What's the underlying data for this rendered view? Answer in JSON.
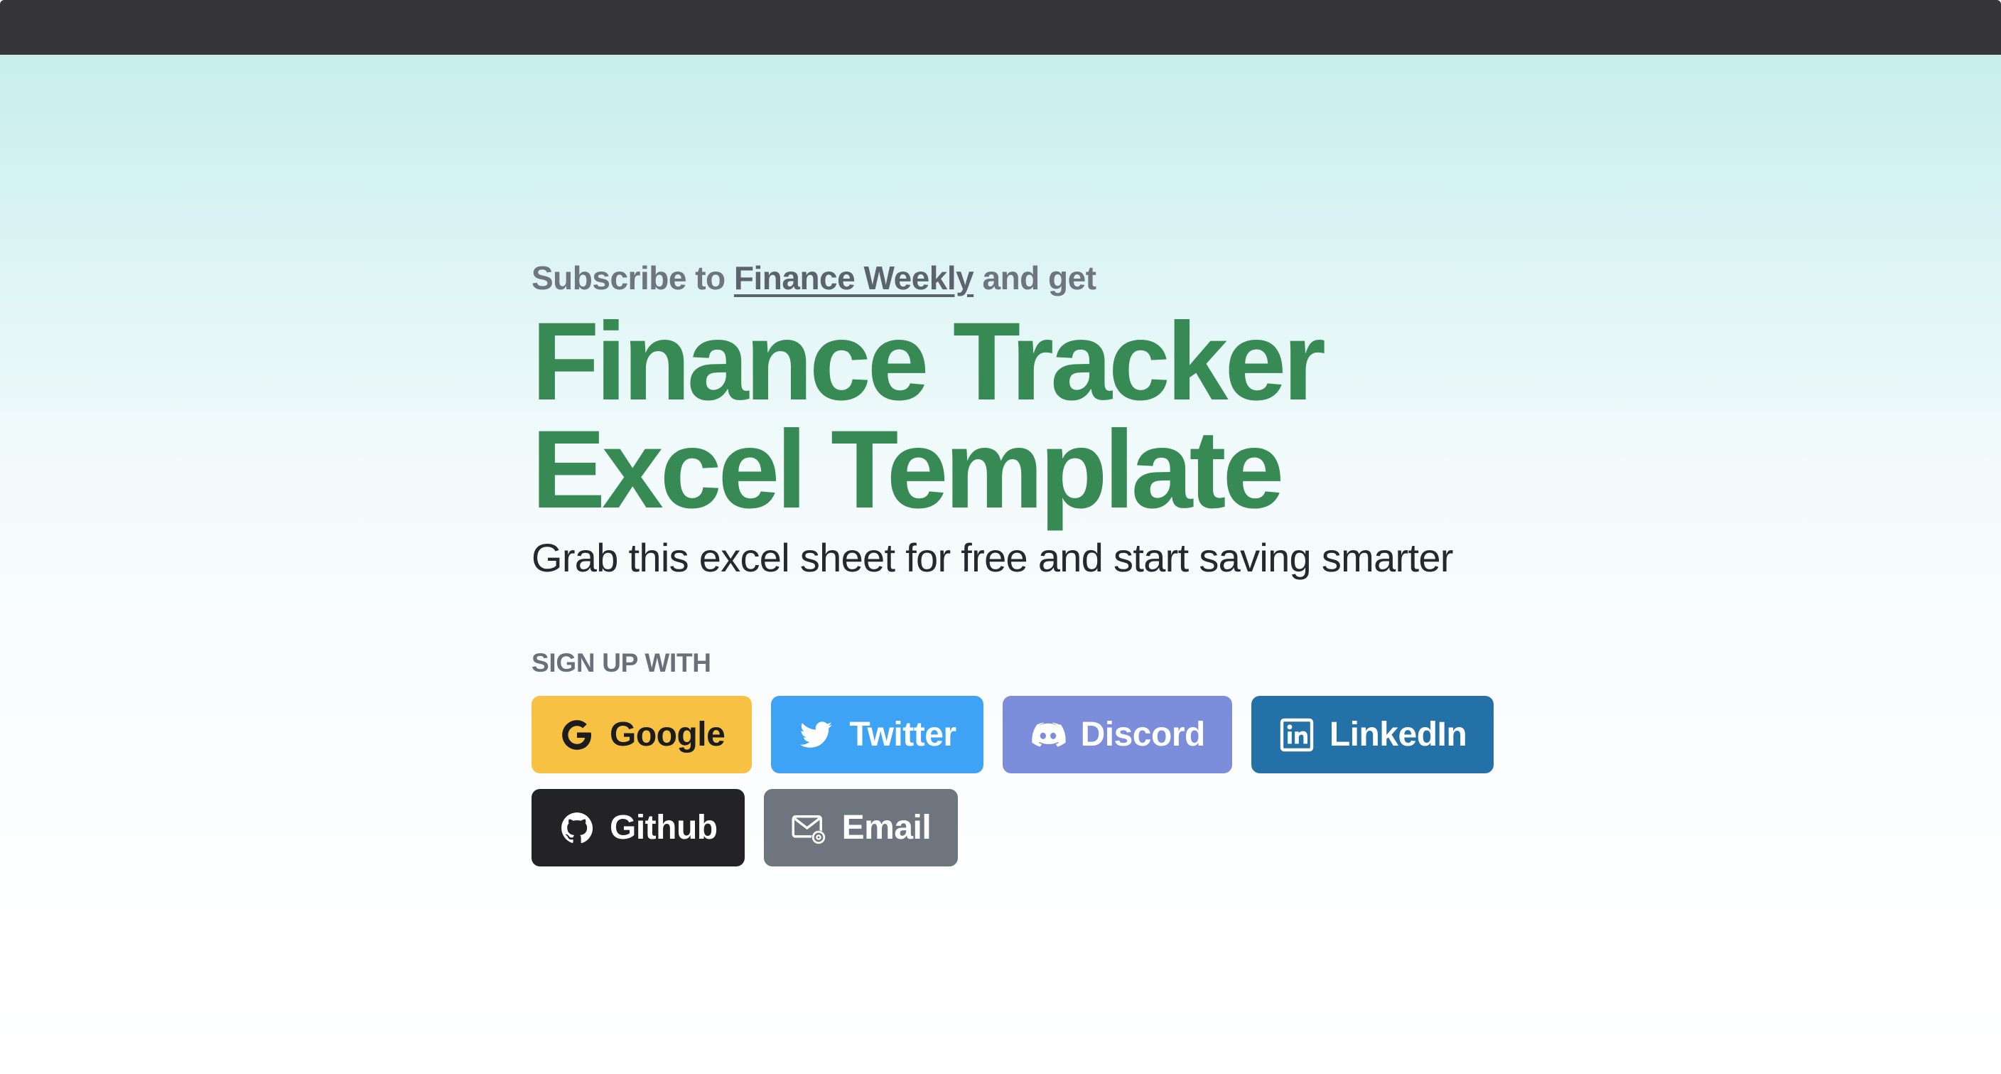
{
  "hero": {
    "eyebrow": {
      "prefix": "Subscribe to",
      "link_text": "Finance Weekly",
      "suffix": "and get"
    },
    "headline": {
      "line1": "Finance Tracker",
      "line2": "Excel Template"
    },
    "subhead": "Grab this excel sheet for free and start saving smarter",
    "signup_label": "SIGN UP WITH"
  },
  "buttons": [
    {
      "label": "Google",
      "icon": "google-icon",
      "color": "#f7c244"
    },
    {
      "label": "Twitter",
      "icon": "twitter-icon",
      "color": "#3ea3f4"
    },
    {
      "label": "Discord",
      "icon": "discord-icon",
      "color": "#7c8ddc"
    },
    {
      "label": "LinkedIn",
      "icon": "linkedin-icon",
      "color": "#2471a7"
    },
    {
      "label": "Github",
      "icon": "github-icon",
      "color": "#232224"
    },
    {
      "label": "Email",
      "icon": "email-icon",
      "color": "#6f757e"
    }
  ],
  "colors": {
    "accent_green": "#388a55",
    "top_bar": "#363639",
    "muted_text": "#6f757e"
  }
}
